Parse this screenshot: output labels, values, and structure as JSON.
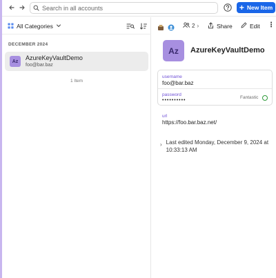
{
  "toolbar": {
    "search_placeholder": "Search in all accounts",
    "new_item_label": "New Item",
    "new_item_color": "#1a66e8"
  },
  "list": {
    "category_label": "All Categories",
    "section_header": "DECEMBER 2024",
    "items": [
      {
        "avatar": "Az",
        "title": "AzureKeyVaultDemo",
        "subtitle": "foo@bar.baz",
        "selected": true
      }
    ],
    "count_label": "1 Item"
  },
  "detail": {
    "share_count": "2",
    "share_label": "Share",
    "edit_label": "Edit",
    "avatar": "Az",
    "title": "AzureKeyVaultDemo",
    "username_label": "username",
    "username_value": "foo@bar.baz",
    "password_label": "password",
    "password_value": "••••••••••",
    "password_strength": "Fantastic",
    "url_label": "url",
    "url_value": "https://foo.bar.baz.net/",
    "last_edited": "Last edited Monday, December 9, 2024 at 10:33:13 AM"
  },
  "colors": {
    "accent_purple": "#a78fe0",
    "field_label": "#6e4fd6",
    "strength_good": "#2e9a3a"
  }
}
